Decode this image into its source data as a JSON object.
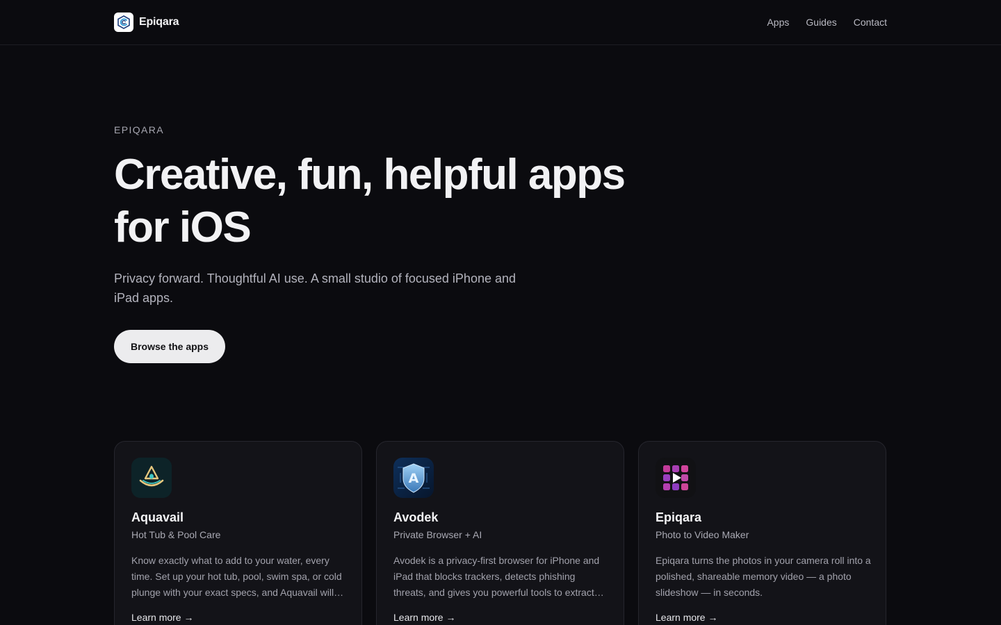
{
  "header": {
    "brand": "Epiqara",
    "logo_icon": "epiqara-logo-icon",
    "nav": [
      {
        "label": "Apps"
      },
      {
        "label": "Guides"
      },
      {
        "label": "Contact"
      }
    ]
  },
  "hero": {
    "eyebrow": "EPIQARA",
    "headline": "Creative, fun, helpful apps for iOS",
    "subhead": "Privacy forward. Thoughtful AI use. A small studio of focused iPhone and iPad apps.",
    "cta_label": "Browse the apps"
  },
  "apps": [
    {
      "name": "Aquavail",
      "tagline": "Hot Tub & Pool Care",
      "description": "Know exactly what to add to your water, every time. Set up your hot tub, pool, swim spa, or cold plunge with your exact specs, and Aquavail will tell you exactly what to add.",
      "link_label": "Learn more →",
      "icon": "aquavail-app-icon"
    },
    {
      "name": "Avodek",
      "tagline": "Private Browser + AI",
      "description": "Avodek is a privacy-first browser for iPhone and iPad that blocks trackers, detects phishing threats, and gives you powerful tools to extract what matters.",
      "link_label": "Learn more →",
      "icon": "avodek-app-icon"
    },
    {
      "name": "Epiqara",
      "tagline": "Photo to Video Maker",
      "description": "Epiqara turns the photos in your camera roll into a polished, shareable memory video — a photo slideshow — in seconds.",
      "link_label": "Learn more →",
      "icon": "epiqara-app-icon"
    }
  ],
  "colors": {
    "background": "#0b0b0f",
    "card": "#131318",
    "cta_background": "#ececee"
  }
}
